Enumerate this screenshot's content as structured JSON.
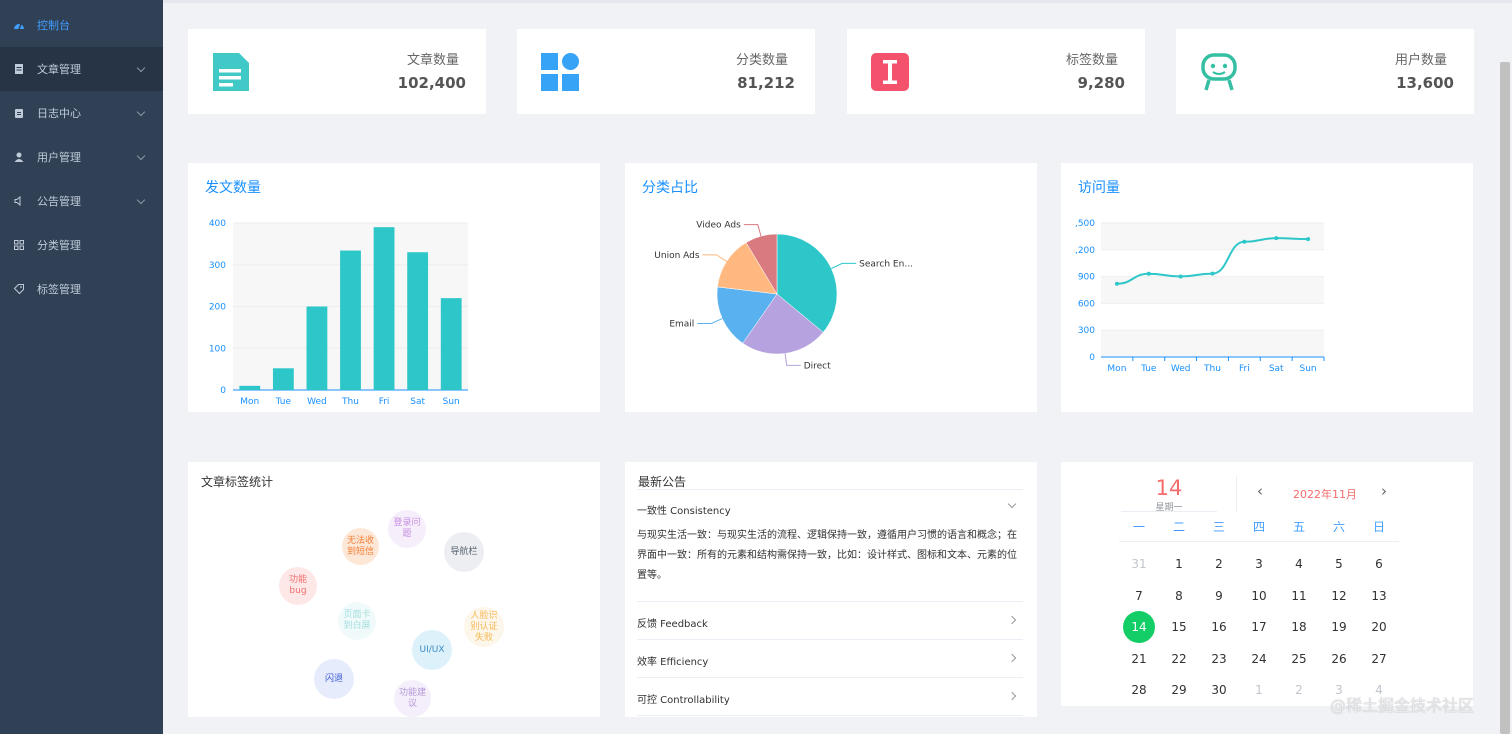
{
  "sidebar": {
    "items": [
      {
        "label": "控制台",
        "icon": "dashboard-icon"
      },
      {
        "label": "文章管理",
        "icon": "document-icon"
      },
      {
        "label": "日志中心",
        "icon": "log-icon"
      },
      {
        "label": "用户管理",
        "icon": "user-icon"
      },
      {
        "label": "公告管理",
        "icon": "speaker-icon"
      },
      {
        "label": "分类管理",
        "icon": "grid-icon"
      },
      {
        "label": "标签管理",
        "icon": "tag-icon"
      }
    ]
  },
  "stats": [
    {
      "label": "文章数量",
      "value": "102,400",
      "icon": "article-icon",
      "color": "#40c9c6"
    },
    {
      "label": "分类数量",
      "value": "81,212",
      "icon": "category-icon",
      "color": "#36a3f7"
    },
    {
      "label": "标签数量",
      "value": "9,280",
      "icon": "tag-icon",
      "color": "#f4516c"
    },
    {
      "label": "用户数量",
      "value": "13,600",
      "icon": "user-face-icon",
      "color": "#34bfa3"
    }
  ],
  "panels": {
    "bar_title": "发文数量",
    "pie_title": "分类占比",
    "line_title": "访问量",
    "tags_title": "文章标签统计",
    "notice_title": "最新公告"
  },
  "chart_data": [
    {
      "type": "bar",
      "title": "发文数量",
      "categories": [
        "Mon",
        "Tue",
        "Wed",
        "Thu",
        "Fri",
        "Sat",
        "Sun"
      ],
      "values": [
        10,
        52,
        200,
        334,
        390,
        330,
        220
      ],
      "ylim": [
        0,
        400
      ],
      "yticks": [
        "0",
        "100",
        "200",
        "300",
        "400"
      ],
      "color": "#2ec7c9"
    },
    {
      "type": "pie",
      "title": "分类占比",
      "labels": [
        "Search En...",
        "Direct",
        "Email",
        "Union Ads",
        "Video Ads"
      ],
      "values": [
        335,
        220,
        160,
        135,
        80
      ],
      "colors": [
        "#2ec7c9",
        "#b6a2de",
        "#5ab1ef",
        "#ffb980",
        "#d87a80"
      ]
    },
    {
      "type": "line",
      "title": "访问量",
      "categories": [
        "Mon",
        "Tue",
        "Wed",
        "Thu",
        "Fri",
        "Sat",
        "Sun"
      ],
      "values": [
        820,
        932,
        901,
        934,
        1290,
        1330,
        1320
      ],
      "ylim": [
        0,
        1500
      ],
      "yticks": [
        "0",
        "300",
        "600",
        "900",
        ",200",
        ",500"
      ],
      "color": "#2ec7c9"
    }
  ],
  "tags": [
    {
      "label": "无法收到短信",
      "color": "#f57c32",
      "bg": "#fde8d8"
    },
    {
      "label": "登录问题",
      "color": "#c48ee0",
      "bg": "#f7eefb"
    },
    {
      "label": "导航栏",
      "color": "#555f6d",
      "bg": "#eceef1"
    },
    {
      "label": "功能bug",
      "color": "#f06e6e",
      "bg": "#fde7e7"
    },
    {
      "label": "页面卡到白屏",
      "color": "#a3dede",
      "bg": "#f1fafa"
    },
    {
      "label": "人脸识别认证失败",
      "color": "#f6b955",
      "bg": "#fdf6ea"
    },
    {
      "label": "UI/UX",
      "color": "#3a8cc7",
      "bg": "#ddf1fa"
    },
    {
      "label": "闪退",
      "color": "#3c5bd6",
      "bg": "#e7ecfd"
    },
    {
      "label": "功能建议",
      "color": "#b49ad8",
      "bg": "#f4effa"
    }
  ],
  "notices": {
    "expanded": {
      "title": "一致性 Consistency",
      "body": "与现实生活一致：与现实生活的流程、逻辑保持一致，遵循用户习惯的语言和概念；在界面中一致：所有的元素和结构需保持一致，比如：设计样式、图标和文本、元素的位置等。"
    },
    "items": [
      "反馈 Feedback",
      "效率 Efficiency",
      "可控 Controllability"
    ]
  },
  "calendar": {
    "day": "14",
    "weekday": "星期一",
    "month_label": "2022年11月",
    "prev": "‹",
    "next": "›",
    "week_headers": [
      "一",
      "二",
      "三",
      "四",
      "五",
      "六",
      "日"
    ],
    "weeks": [
      [
        "31",
        "1",
        "2",
        "3",
        "4",
        "5",
        "6"
      ],
      [
        "7",
        "8",
        "9",
        "10",
        "11",
        "12",
        "13"
      ],
      [
        "14",
        "15",
        "16",
        "17",
        "18",
        "19",
        "20"
      ],
      [
        "21",
        "22",
        "23",
        "24",
        "25",
        "26",
        "27"
      ],
      [
        "28",
        "29",
        "30",
        "1",
        "2",
        "3",
        "4"
      ]
    ],
    "selected": "14",
    "accent": "#13ce66"
  },
  "watermark": "@稀土掘金技术社区"
}
